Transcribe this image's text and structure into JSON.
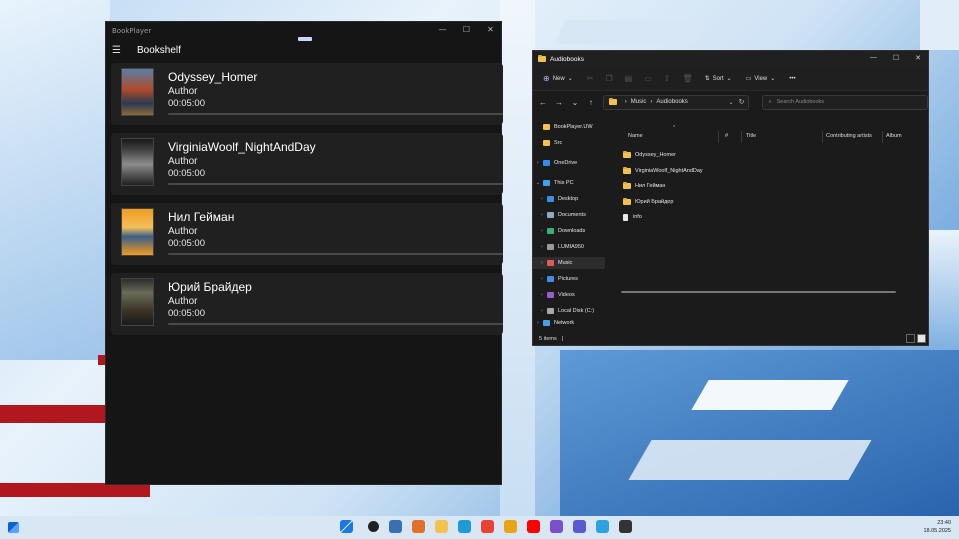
{
  "bookplayer": {
    "window_title": "BookPlayer",
    "controls": {
      "minimize": "—",
      "maximize": "☐",
      "close": "✕"
    },
    "menu_icon": "☰",
    "page_title": "Bookshelf",
    "books": [
      {
        "title": "Odyssey_Homer",
        "author": "Author",
        "duration": "00:05:00",
        "progress": 0
      },
      {
        "title": "VirginiaWoolf_NightAndDay",
        "author": "Author",
        "duration": "00:05:00",
        "progress": 0
      },
      {
        "title": "Нил Гейман",
        "author": "Author",
        "duration": "00:05:00",
        "progress": 0
      },
      {
        "title": "Юрий Брайдер",
        "author": "Author",
        "duration": "00:05:00",
        "progress": 0
      }
    ]
  },
  "explorer": {
    "window_title": "Audiobooks",
    "controls": {
      "minimize": "—",
      "maximize": "☐",
      "close": "✕"
    },
    "toolbar": {
      "new_label": "New",
      "new_icon": "⊕",
      "sort_label": "Sort",
      "sort_icon": "⇅",
      "view_label": "View",
      "view_icon": "▭",
      "more_label": "•••",
      "dropdown": "⌄"
    },
    "nav": {
      "back": "←",
      "forward": "→",
      "recent": "⌄",
      "up": "↑"
    },
    "breadcrumb": {
      "part1": "Music",
      "sep": "›",
      "part2": "Audiobooks",
      "dropdown": "⌄",
      "refresh": "↻"
    },
    "search_placeholder": "Search Audiobooks",
    "search_icon": "⌕",
    "nav_pane": [
      {
        "label": "BookPlayer.UW",
        "color": "#f2c14e",
        "chevron": ""
      },
      {
        "label": "Src",
        "color": "#f2c14e",
        "chevron": ""
      },
      {
        "label": "OneDrive",
        "color": "#2f8cf0",
        "chevron": "›"
      },
      {
        "label": "This PC",
        "color": "#3aa0f0",
        "chevron": "⌄"
      },
      {
        "label": "Desktop",
        "color": "#3b8fe0",
        "chevron": "›"
      },
      {
        "label": "Documents",
        "color": "#8fa7c8",
        "chevron": "›"
      },
      {
        "label": "Downloads",
        "color": "#3ab070",
        "chevron": "›"
      },
      {
        "label": "LUMIA950",
        "color": "#9a9a9a",
        "chevron": "›"
      },
      {
        "label": "Music",
        "color": "#e05a5a",
        "chevron": "›"
      },
      {
        "label": "Pictures",
        "color": "#3f8fe8",
        "chevron": "›"
      },
      {
        "label": "Videos",
        "color": "#9a5ad0",
        "chevron": "›"
      },
      {
        "label": "Local Disk (C:)",
        "color": "#a8a8a8",
        "chevron": "›"
      },
      {
        "label": "Network",
        "color": "#4aa0e0",
        "chevron": "›"
      }
    ],
    "columns": {
      "name": "Name",
      "number": "#",
      "title": "Title",
      "artists": "Contributing artists",
      "album": "Album",
      "sort_arrow": "^"
    },
    "files": [
      {
        "name": "Odyssey_Homer",
        "type": "folder"
      },
      {
        "name": "VirginiaWoolf_NightAndDay",
        "type": "folder"
      },
      {
        "name": "Нил Гейман",
        "type": "folder"
      },
      {
        "name": "Юрий Брайдер",
        "type": "folder"
      },
      {
        "name": "info",
        "type": "file"
      }
    ],
    "status_text": "5 items",
    "status_sep": "|"
  },
  "taskbar": {
    "time": "23:40",
    "date": "18.05.2025",
    "apps": [
      {
        "name": "start",
        "color": "#1a78e6"
      },
      {
        "name": "search",
        "color": "#222222"
      },
      {
        "name": "task-view",
        "color": "#3a6fb0"
      },
      {
        "name": "copilot",
        "color": "#e0702a"
      },
      {
        "name": "file-explorer",
        "color": "#f2c14e"
      },
      {
        "name": "edge",
        "color": "#1f9ad6"
      },
      {
        "name": "chrome",
        "color": "#e94235"
      },
      {
        "name": "yandex",
        "color": "#e8a317"
      },
      {
        "name": "youtube",
        "color": "#ff0000"
      },
      {
        "name": "visual-studio",
        "color": "#7a4fc7"
      },
      {
        "name": "save-app",
        "color": "#5a5ad0"
      },
      {
        "name": "telegram",
        "color": "#2aa3e0"
      },
      {
        "name": "terminal",
        "color": "#333333"
      }
    ]
  }
}
